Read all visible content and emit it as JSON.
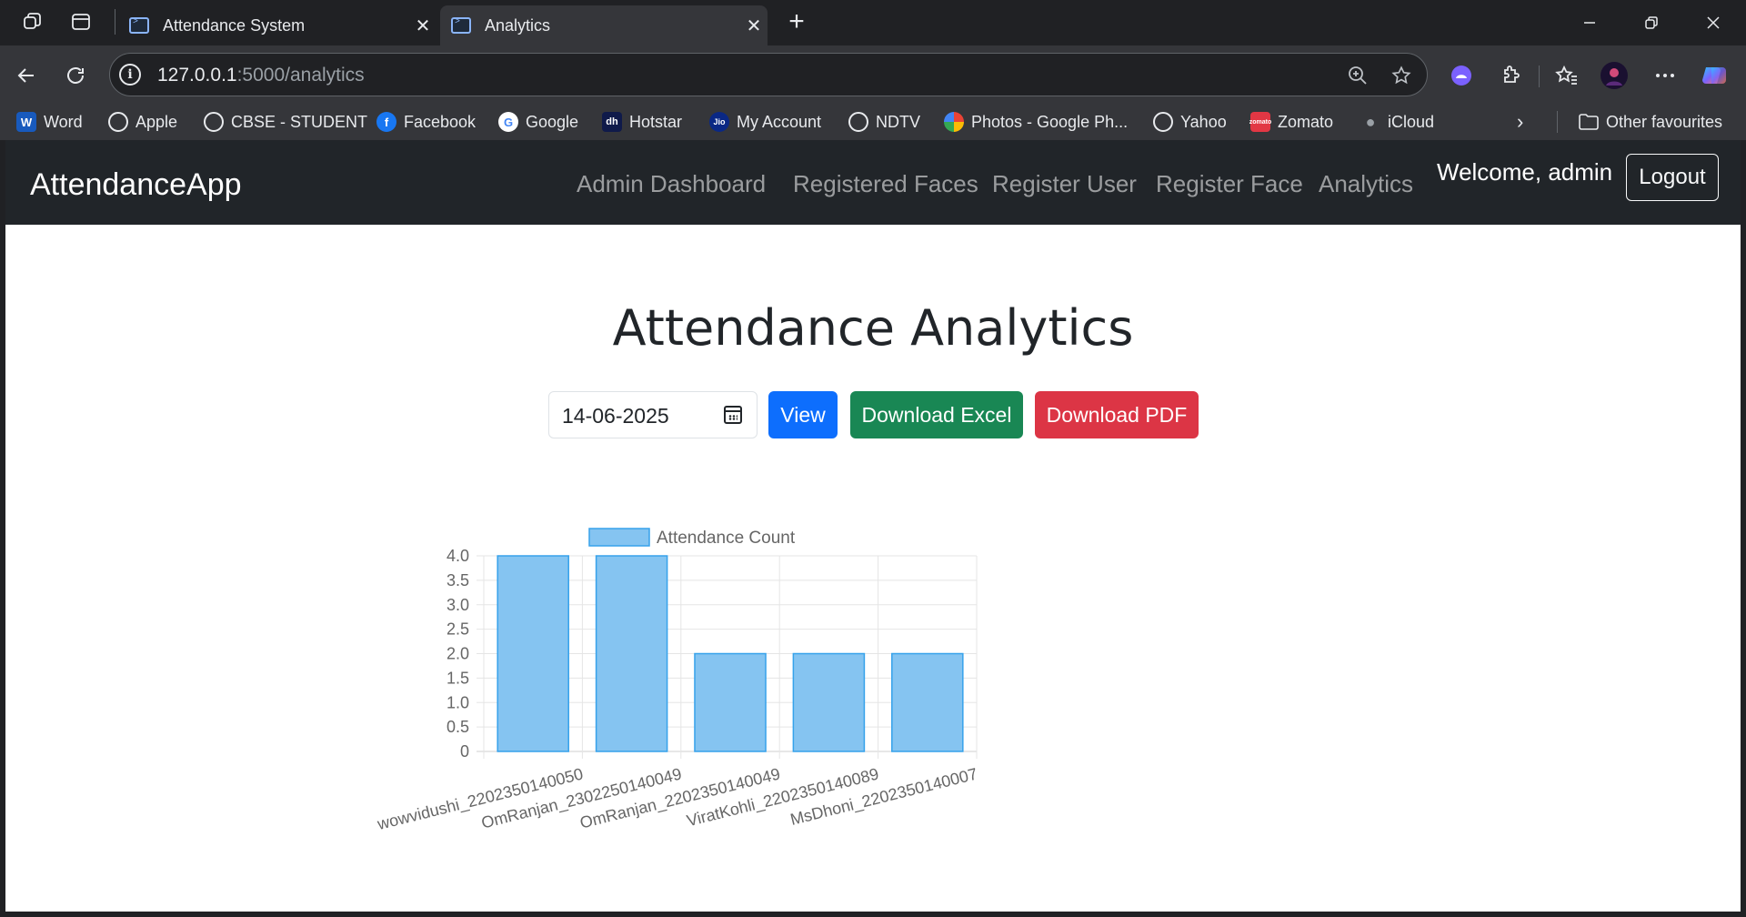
{
  "browser": {
    "tabs": [
      {
        "title": "Attendance System",
        "active": false
      },
      {
        "title": "Analytics",
        "active": true
      }
    ],
    "url_host": "127.0.0.1",
    "url_path": ":5000/analytics",
    "bookmarks": [
      {
        "label": "Word",
        "icon": "word-icon"
      },
      {
        "label": "Apple",
        "icon": "globe-icon"
      },
      {
        "label": "CBSE - STUDENT",
        "icon": "globe-icon"
      },
      {
        "label": "Facebook",
        "icon": "facebook-icon"
      },
      {
        "label": "Google",
        "icon": "google-icon"
      },
      {
        "label": "Hotstar",
        "icon": "hotstar-icon"
      },
      {
        "label": "My Account",
        "icon": "jio-icon"
      },
      {
        "label": "NDTV",
        "icon": "globe-icon"
      },
      {
        "label": "Photos - Google Ph...",
        "icon": "photos-icon"
      },
      {
        "label": "Yahoo",
        "icon": "globe-icon"
      },
      {
        "label": "Zomato",
        "icon": "zomato-icon"
      },
      {
        "label": "iCloud",
        "icon": "apple-icon"
      }
    ],
    "other_favourites": "Other favourites"
  },
  "navbar": {
    "brand": "AttendanceApp",
    "links": [
      "Admin Dashboard",
      "Registered Faces",
      "Register User",
      "Register Face",
      "Analytics"
    ],
    "welcome": "Welcome, admin",
    "logout": "Logout"
  },
  "page": {
    "title": "Attendance Analytics",
    "date_value": "14-06-2025",
    "view_label": "View",
    "excel_label": "Download Excel",
    "pdf_label": "Download PDF"
  },
  "colors": {
    "bar_fill": "#85c4f1",
    "bar_border": "#36a2eb",
    "btn_view": "#0d6efd",
    "btn_excel": "#198754",
    "btn_pdf": "#dc3545",
    "navbar_bg": "#212529"
  },
  "chart_data": {
    "type": "bar",
    "categories": [
      "wowvidushi_2202350140050",
      "OmRanjan_2302250140049",
      "OmRanjan_2202350140049",
      "ViratKohli_2202350140089",
      "MsDhoni_2202350140007"
    ],
    "series": [
      {
        "name": "Attendance Count",
        "values": [
          4,
          4,
          2,
          2,
          2
        ]
      }
    ],
    "ylim": [
      0,
      4
    ],
    "yticks": [
      "0",
      "0.5",
      "1.0",
      "1.5",
      "2.0",
      "2.5",
      "3.0",
      "3.5",
      "4.0"
    ],
    "grid": true,
    "legend": "top"
  }
}
